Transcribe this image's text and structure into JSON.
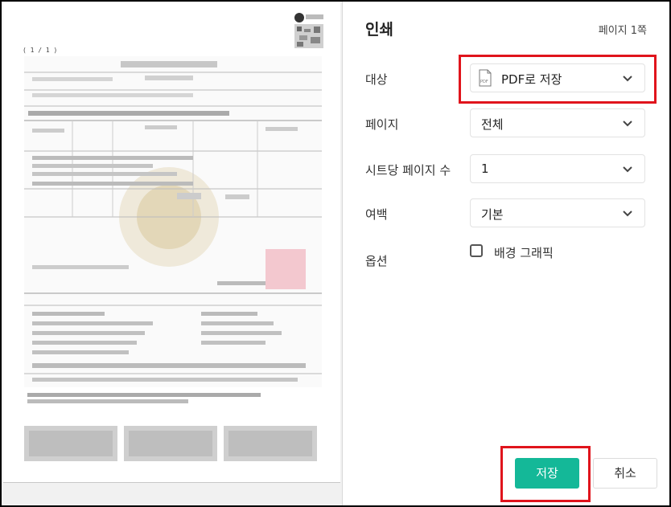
{
  "preview": {
    "page_counter": "( 1 / 1 )"
  },
  "panel": {
    "title": "인쇄",
    "page_count": "페이지 1쪽",
    "destination": {
      "label": "대상",
      "value": "PDF로 저장",
      "icon": "pdf-file-icon"
    },
    "pages": {
      "label": "페이지",
      "value": "전체"
    },
    "pages_per_sheet": {
      "label": "시트당 페이지 수",
      "value": "1"
    },
    "margins": {
      "label": "여백",
      "value": "기본"
    },
    "options": {
      "label": "옵션",
      "checkbox_label": "배경 그래픽",
      "checked": false
    },
    "save_label": "저장",
    "cancel_label": "취소"
  },
  "colors": {
    "accent": "#14b898",
    "highlight": "#e0141c"
  }
}
